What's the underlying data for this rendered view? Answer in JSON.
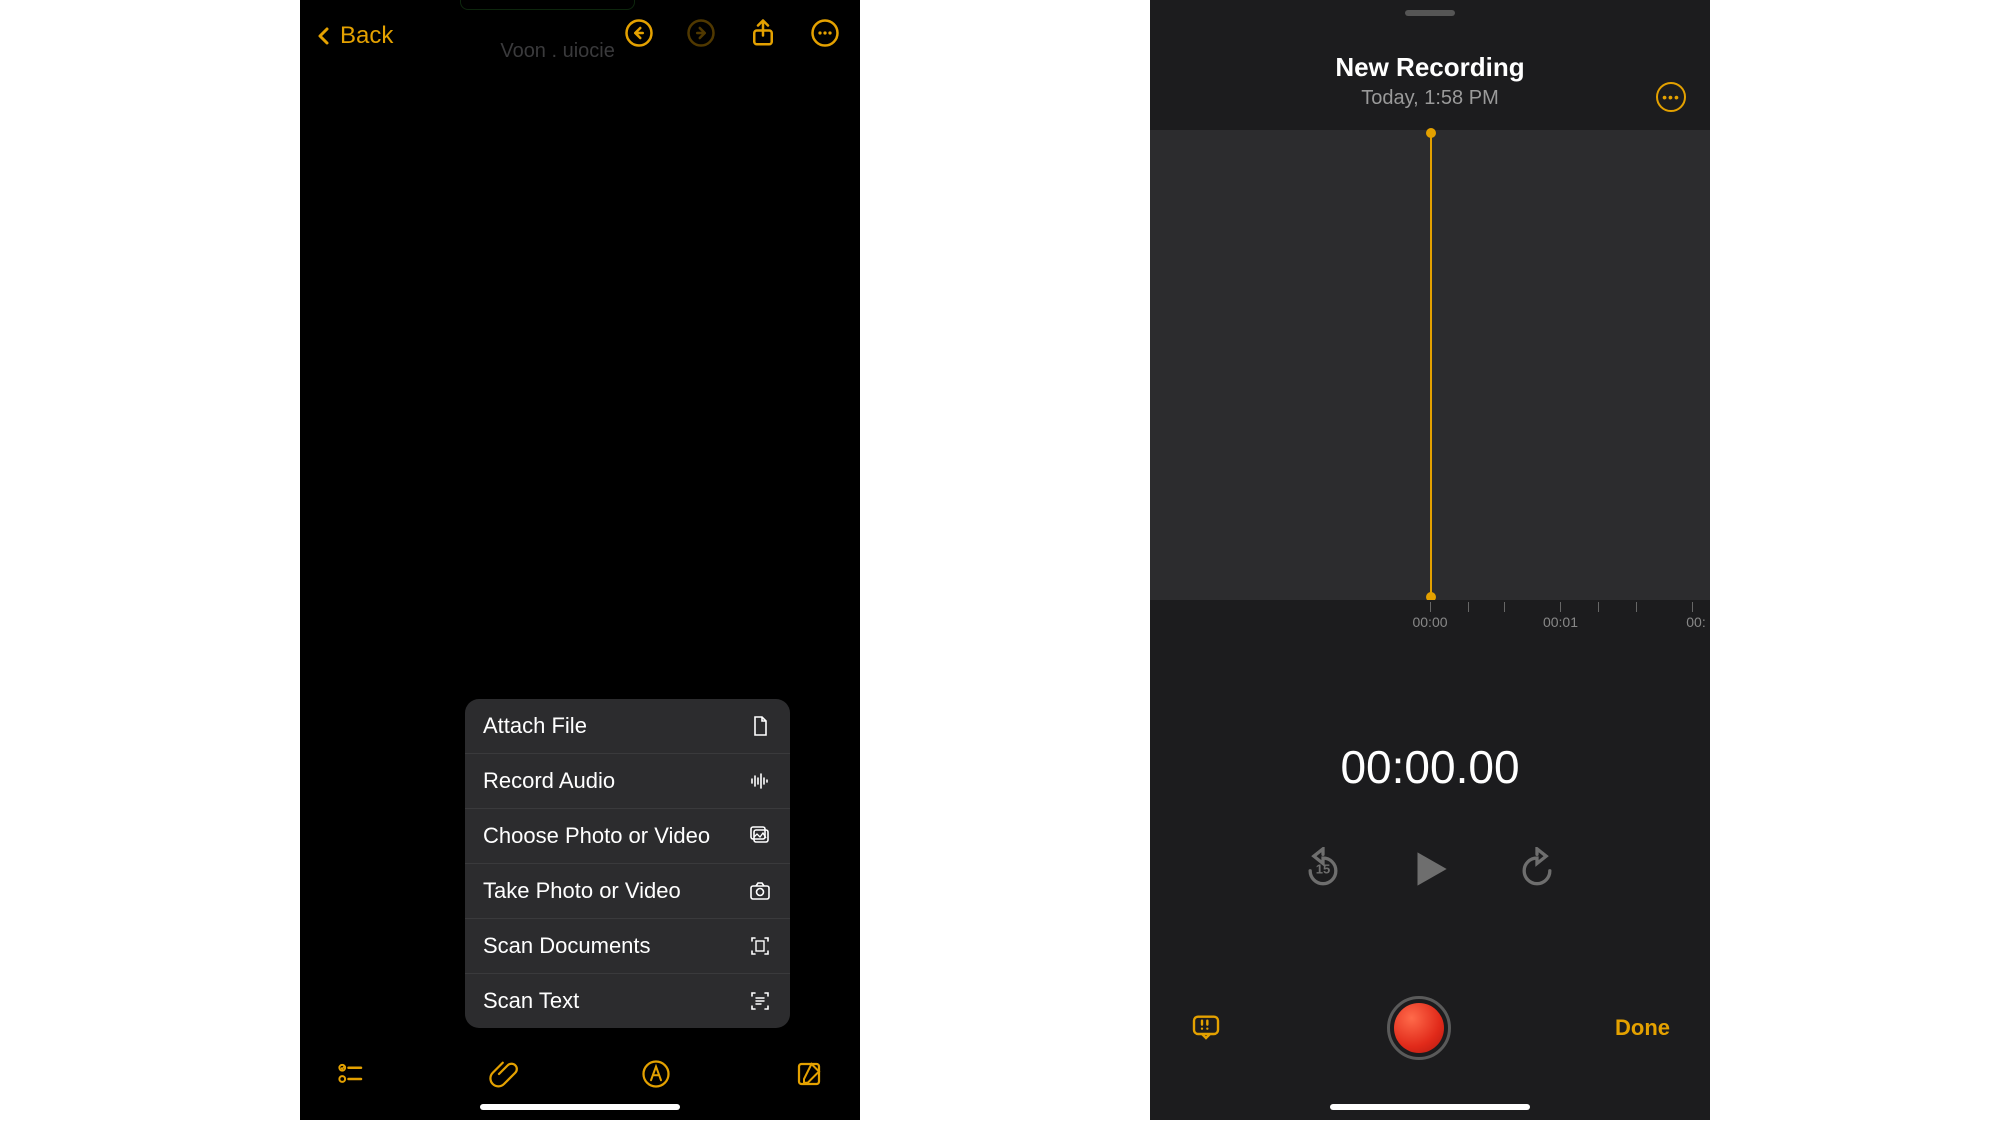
{
  "notes": {
    "back_label": "Back",
    "ghost_text": "Voon . uiocie",
    "menu": {
      "attach_file": "Attach File",
      "record_audio": "Record Audio",
      "choose_media": "Choose Photo or Video",
      "take_media": "Take Photo or Video",
      "scan_documents": "Scan Documents",
      "scan_text": "Scan Text"
    }
  },
  "voice": {
    "title": "New Recording",
    "subtitle": "Today, 1:58 PM",
    "ruler": {
      "t0": "00:00",
      "t1": "00:01",
      "t2": "00:"
    },
    "elapsed": "00:00.00",
    "skip_seconds": "15",
    "done_label": "Done"
  }
}
